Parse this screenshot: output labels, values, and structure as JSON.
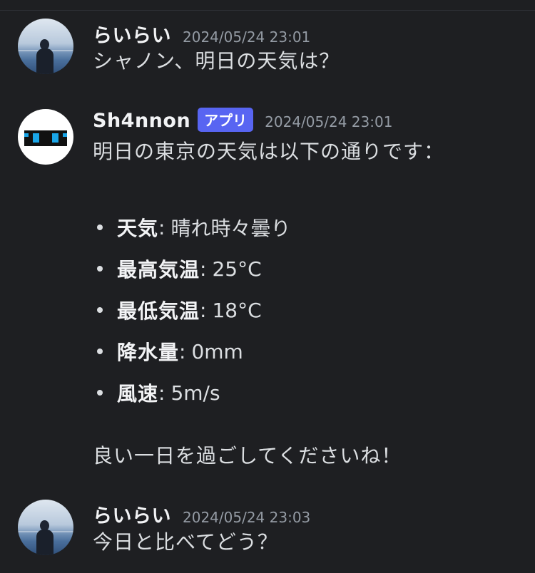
{
  "messages": [
    {
      "username": "らいらい",
      "timestamp": "2024/05/24 23:01",
      "text": "シャノン、明日の天気は？"
    },
    {
      "username": "Sh4nnon",
      "badge": "アプリ",
      "timestamp": "2024/05/24 23:01",
      "intro": "明日の東京の天気は以下の通りです：",
      "items": [
        {
          "key": "天気",
          "sep": ":",
          "value": "晴れ時々曇り"
        },
        {
          "key": "最高気温",
          "sep": ":",
          "value": "25°C"
        },
        {
          "key": "最低気温",
          "sep": ":",
          "value": "18°C"
        },
        {
          "key": "降水量",
          "sep": ":",
          "value": "0mm"
        },
        {
          "key": "風速",
          "sep": ":",
          "value": "5m/s"
        }
      ],
      "outro": "良い一日を過ごしてくださいね！"
    },
    {
      "username": "らいらい",
      "timestamp": "2024/05/24 23:03",
      "text": "今日と比べてどう？"
    }
  ],
  "colors": {
    "background": "#1e1f22",
    "app_badge": "#5865f2",
    "timestamp": "#949ba4",
    "text": "#dbdee1"
  },
  "icons": {
    "user_avatar": "beach-photo-avatar",
    "bot_avatar": "robot-face-avatar"
  }
}
